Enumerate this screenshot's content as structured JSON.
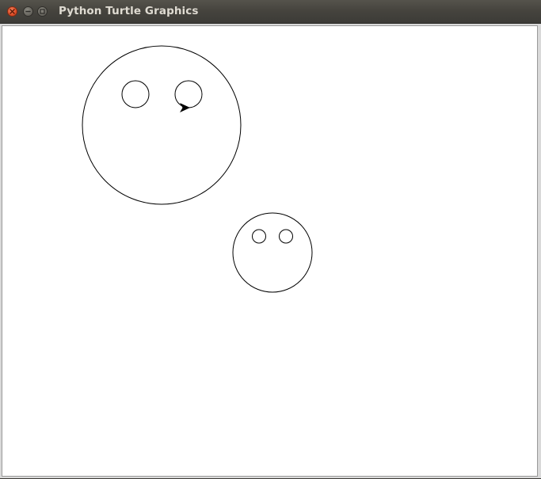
{
  "window": {
    "title": "Python Turtle Graphics"
  },
  "controls": {
    "close_icon": "close-x-icon",
    "minimize_icon": "minimize-dash-icon",
    "maximize_icon": "maximize-square-icon"
  },
  "canvas": {
    "background_color": "#ffffff",
    "stroke_color": "#000000",
    "shapes": [
      "large-face-head-circle",
      "large-face-left-eye-circle",
      "large-face-right-eye-circle",
      "small-face-head-circle",
      "small-face-left-eye-circle",
      "small-face-right-eye-circle"
    ],
    "turtle_icon": "turtle-arrow-cursor-icon"
  },
  "colors": {
    "close_button": "#e2502a",
    "titlebar": "#46443e",
    "title_text": "#dfdbd2"
  }
}
